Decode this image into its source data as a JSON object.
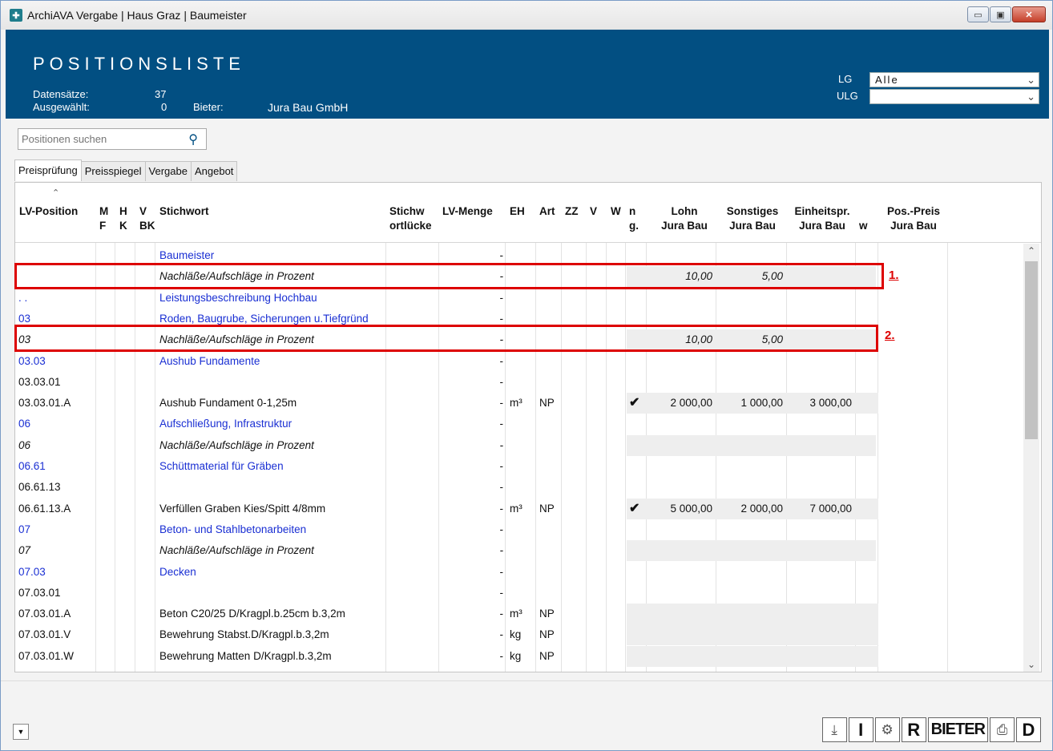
{
  "window": {
    "title": "ArchiAVA Vergabe | Haus Graz | Baumeister",
    "buttons": {
      "minimize": "▭",
      "maximize": "▣",
      "close": "✕"
    }
  },
  "header": {
    "title": "POSITIONSLISTE",
    "datensaetze_label": "Datensätze:",
    "datensaetze_value": "37",
    "ausgewaehlt_label": "Ausgewählt:",
    "ausgewaehlt_value": "0",
    "bieter_label": "Bieter:",
    "bieter_value": "Jura Bau GmbH",
    "lg_label": "LG",
    "lg_value": "Alle",
    "ulg_label": "ULG",
    "ulg_value": ""
  },
  "search": {
    "placeholder": "Positionen suchen",
    "icon": "search-icon"
  },
  "tabs": [
    "Preisprüfung",
    "Preisspiegel",
    "Vergabe",
    "Angebot"
  ],
  "columns": {
    "lvpos": "LV-Position",
    "mf": "M\nF",
    "hk": "H\nK",
    "vbk": "V\nBK",
    "stichwort": "Stichwort",
    "stichwortluecke": "Stichw\nortlücke",
    "lvmenge": "LV-Menge",
    "eh": "EH",
    "art": "Art",
    "zz": "ZZ",
    "v": "V",
    "w": "W",
    "ing": "n\ng.",
    "lohn": "Lohn\nJura Bau",
    "sonstiges": "Sonstiges\nJura Bau",
    "einheitspr": "Einheitspr.\nJura Bau",
    "ow": "\nw",
    "pospreis": "Pos.-Preis\nJura Bau"
  },
  "rows": [
    {
      "pos": "",
      "stichwort": "Baumeister",
      "menge": "-",
      "eh": "",
      "art": "",
      "check": "",
      "lohn": "",
      "sonst": "",
      "ep": "",
      "style": "blue"
    },
    {
      "pos": "",
      "stichwort": "Nachläße/Aufschläge in Prozent",
      "menge": "-",
      "eh": "",
      "art": "",
      "check": "",
      "lohn": "10,00",
      "sonst": "5,00",
      "ep": "",
      "style": "pct"
    },
    {
      "pos": ". .",
      "stichwort": "Leistungsbeschreibung Hochbau",
      "menge": "-",
      "eh": "",
      "art": "",
      "check": "",
      "lohn": "",
      "sonst": "",
      "ep": "",
      "style": "blue"
    },
    {
      "pos": "03",
      "stichwort": "Roden, Baugrube, Sicherungen u.Tiefgründ",
      "menge": "-",
      "eh": "",
      "art": "",
      "check": "",
      "lohn": "",
      "sonst": "",
      "ep": "",
      "style": "blue"
    },
    {
      "pos": "03",
      "stichwort": "Nachläße/Aufschläge in Prozent",
      "menge": "-",
      "eh": "",
      "art": "",
      "check": "",
      "lohn": "10,00",
      "sonst": "5,00",
      "ep": "",
      "style": "pct"
    },
    {
      "pos": "03.03",
      "stichwort": "Aushub Fundamente",
      "menge": "-",
      "eh": "",
      "art": "",
      "check": "",
      "lohn": "",
      "sonst": "",
      "ep": "",
      "style": "blue"
    },
    {
      "pos": "03.03.01",
      "stichwort": "",
      "menge": "-",
      "eh": "",
      "art": "",
      "check": "",
      "lohn": "",
      "sonst": "",
      "ep": "",
      "style": "plain"
    },
    {
      "pos": "03.03.01.A",
      "stichwort": "Aushub Fundament 0-1,25m",
      "menge": "-",
      "eh": "m³",
      "art": "NP",
      "check": "✔",
      "lohn": "2 000,00",
      "sonst": "1 000,00",
      "ep": "3 000,00",
      "style": "plain"
    },
    {
      "pos": "06",
      "stichwort": "Aufschließung, Infrastruktur",
      "menge": "-",
      "eh": "",
      "art": "",
      "check": "",
      "lohn": "",
      "sonst": "",
      "ep": "",
      "style": "blue"
    },
    {
      "pos": "06",
      "stichwort": "Nachläße/Aufschläge in Prozent",
      "menge": "-",
      "eh": "",
      "art": "",
      "check": "",
      "lohn": "",
      "sonst": "",
      "ep": "",
      "style": "pct"
    },
    {
      "pos": "06.61",
      "stichwort": "Schüttmaterial für Gräben",
      "menge": "-",
      "eh": "",
      "art": "",
      "check": "",
      "lohn": "",
      "sonst": "",
      "ep": "",
      "style": "blue"
    },
    {
      "pos": "06.61.13",
      "stichwort": "",
      "menge": "-",
      "eh": "",
      "art": "",
      "check": "",
      "lohn": "",
      "sonst": "",
      "ep": "",
      "style": "plain"
    },
    {
      "pos": "06.61.13.A",
      "stichwort": "Verfüllen Graben Kies/Spitt 4/8mm",
      "menge": "-",
      "eh": "m³",
      "art": "NP",
      "check": "✔",
      "lohn": "5 000,00",
      "sonst": "2 000,00",
      "ep": "7 000,00",
      "style": "plain"
    },
    {
      "pos": "07",
      "stichwort": "Beton- und Stahlbetonarbeiten",
      "menge": "-",
      "eh": "",
      "art": "",
      "check": "",
      "lohn": "",
      "sonst": "",
      "ep": "",
      "style": "blue"
    },
    {
      "pos": "07",
      "stichwort": "Nachläße/Aufschläge in Prozent",
      "menge": "-",
      "eh": "",
      "art": "",
      "check": "",
      "lohn": "",
      "sonst": "",
      "ep": "",
      "style": "pct"
    },
    {
      "pos": "07.03",
      "stichwort": "Decken",
      "menge": "-",
      "eh": "",
      "art": "",
      "check": "",
      "lohn": "",
      "sonst": "",
      "ep": "",
      "style": "blue"
    },
    {
      "pos": "07.03.01",
      "stichwort": "",
      "menge": "-",
      "eh": "",
      "art": "",
      "check": "",
      "lohn": "",
      "sonst": "",
      "ep": "",
      "style": "plain"
    },
    {
      "pos": "07.03.01.A",
      "stichwort": "Beton C20/25 D/Kragpl.b.25cm b.3,2m",
      "menge": "-",
      "eh": "m³",
      "art": "NP",
      "check": "",
      "lohn": "",
      "sonst": "",
      "ep": "",
      "style": "plain"
    },
    {
      "pos": "07.03.01.V",
      "stichwort": "Bewehrung Stabst.D/Kragpl.b.3,2m",
      "menge": "-",
      "eh": "kg",
      "art": "NP",
      "check": "",
      "lohn": "",
      "sonst": "",
      "ep": "",
      "style": "plain"
    },
    {
      "pos": "07.03.01.W",
      "stichwort": "Bewehrung Matten D/Kragpl.b.3,2m",
      "menge": "-",
      "eh": "kg",
      "art": "NP",
      "check": "",
      "lohn": "",
      "sonst": "",
      "ep": "",
      "style": "plain"
    }
  ],
  "annotations": [
    "1.",
    "2."
  ],
  "footer": {
    "buttons": [
      {
        "name": "download-icon",
        "label": "⤓",
        "kind": "icon"
      },
      {
        "name": "i-button",
        "label": "I",
        "kind": "letter"
      },
      {
        "name": "gear-icon",
        "label": "⚙",
        "kind": "icon"
      },
      {
        "name": "r-button",
        "label": "R",
        "kind": "letter"
      },
      {
        "name": "bieter-button",
        "label": "BIETER",
        "kind": "text"
      },
      {
        "name": "print-icon",
        "label": "⎙",
        "kind": "icon"
      },
      {
        "name": "d-button",
        "label": "D",
        "kind": "letter"
      }
    ],
    "dropdown": "▼"
  }
}
